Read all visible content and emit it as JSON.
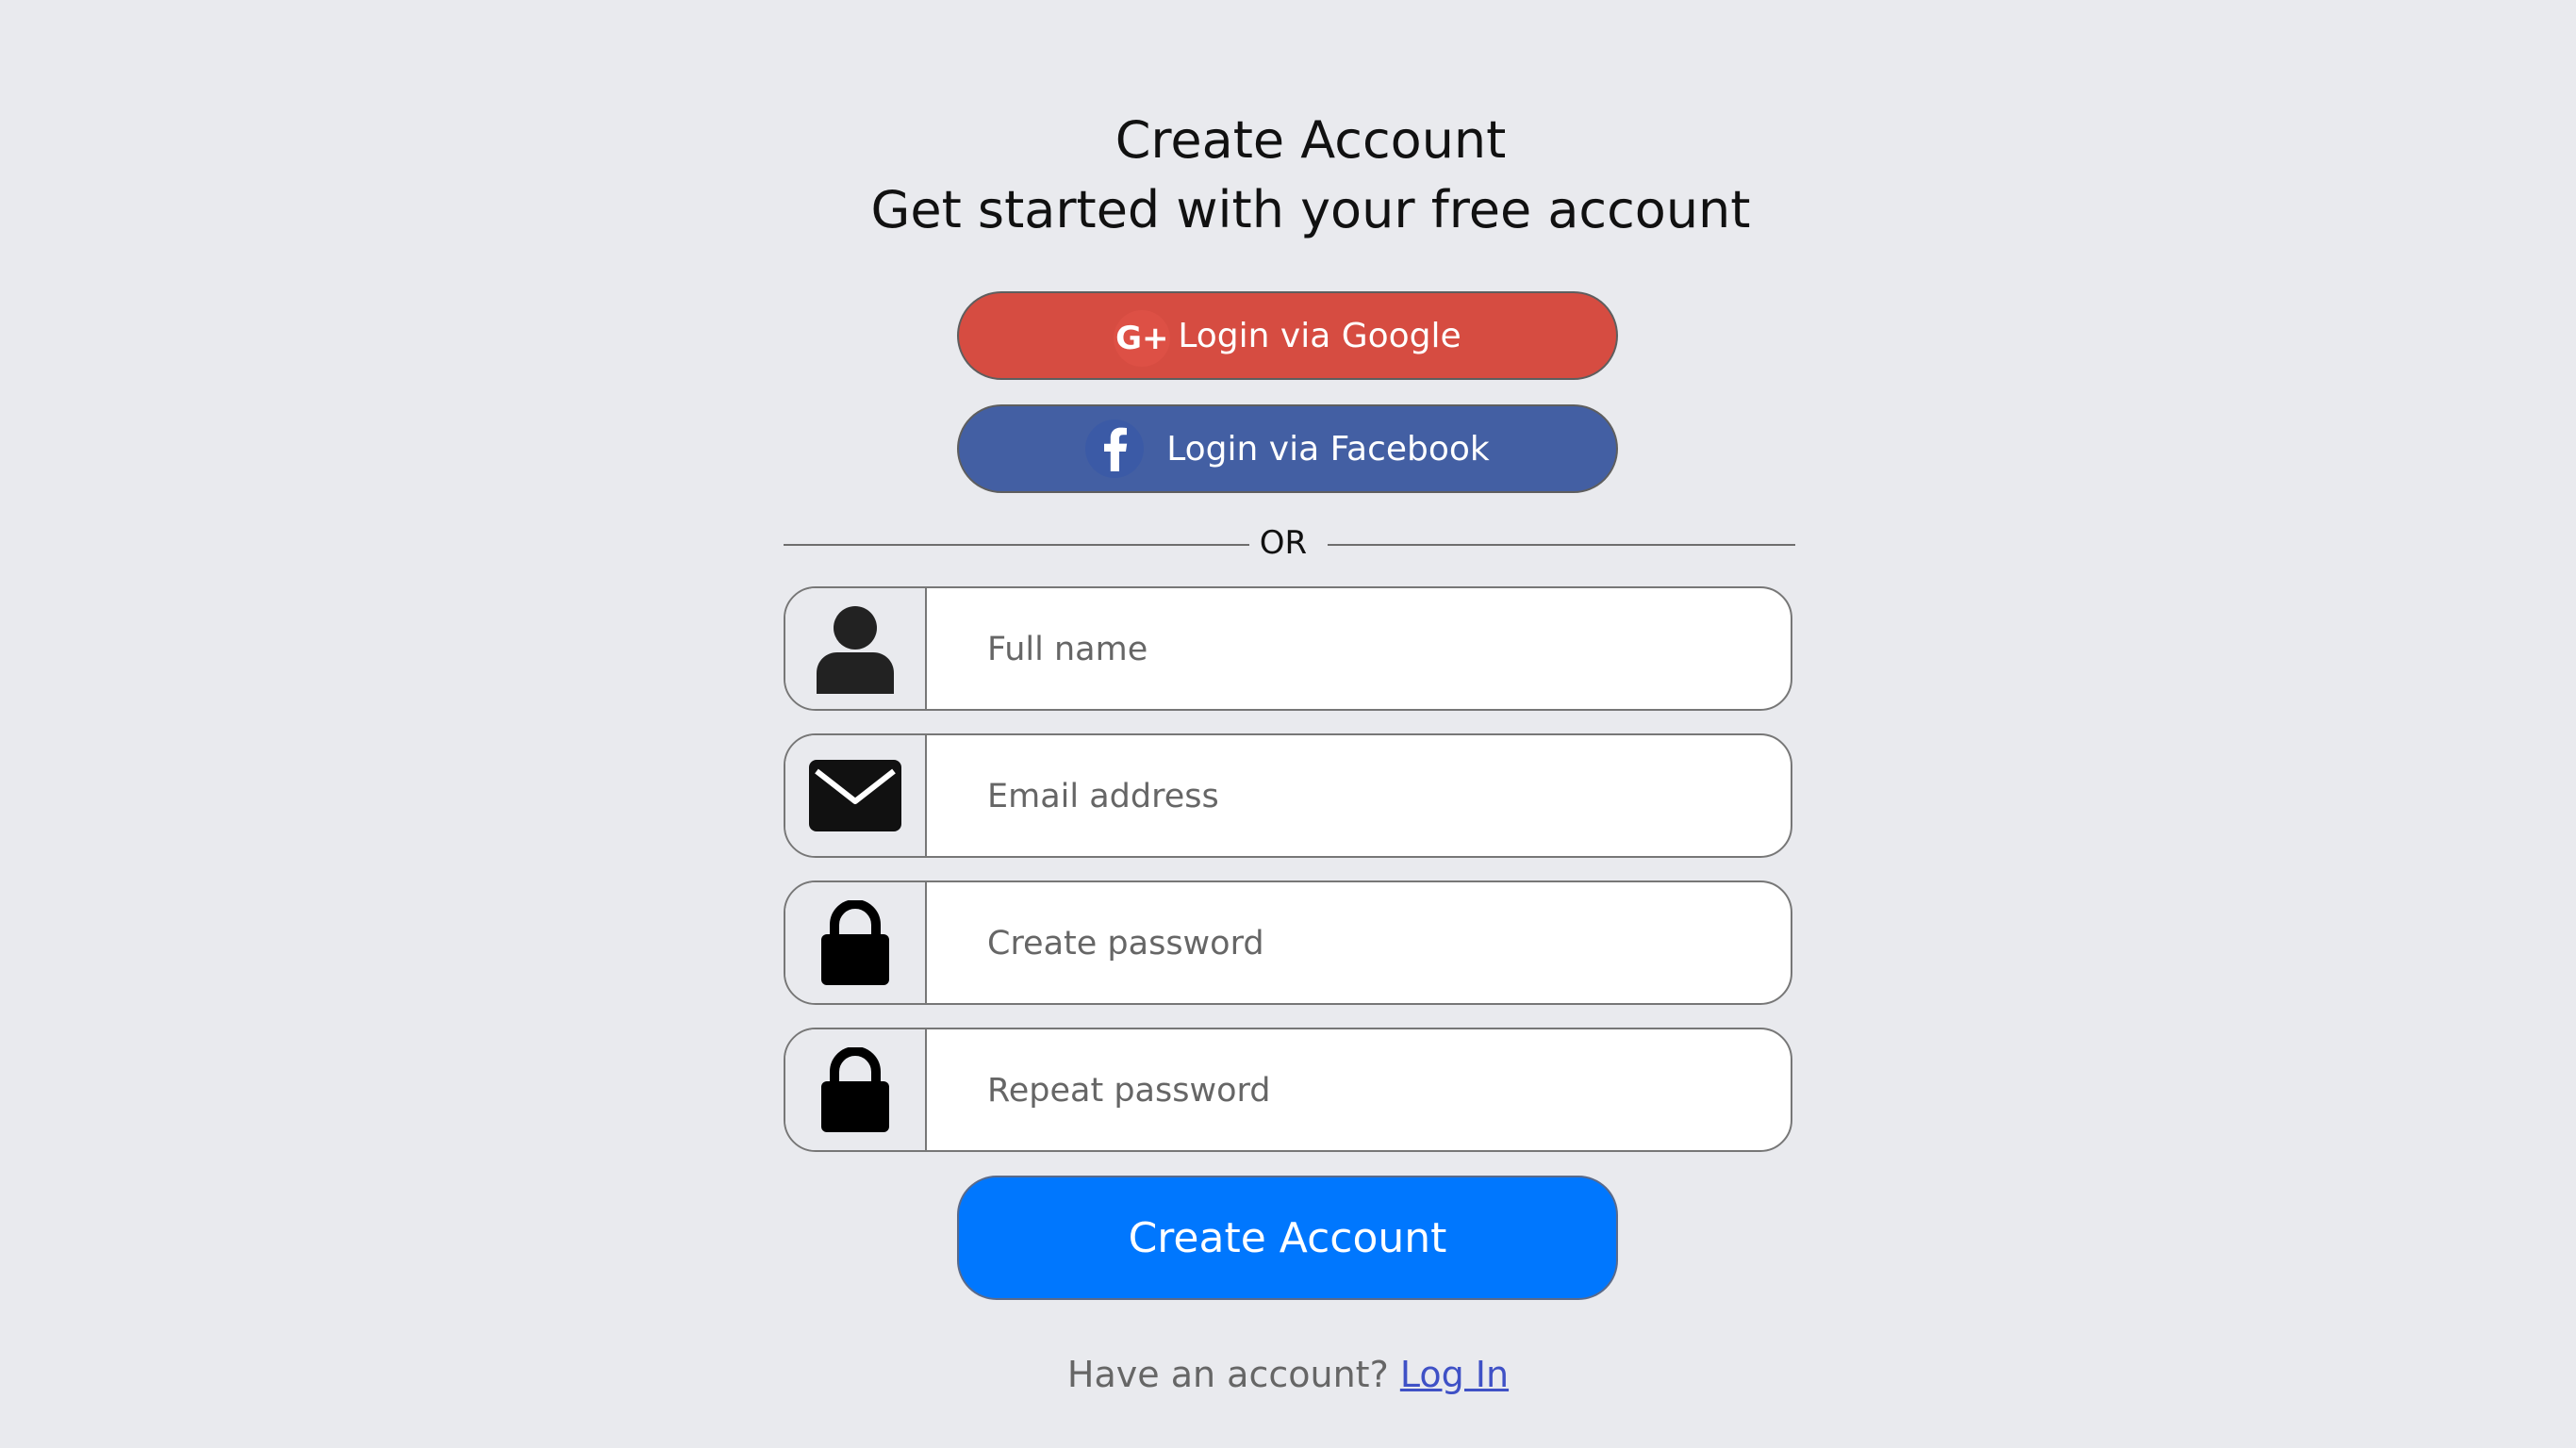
{
  "header": {
    "title": "Create Account",
    "subtitle": "Get started with your free account"
  },
  "social": {
    "google_label": "Login via Google",
    "google_icon": "google-plus-icon",
    "google_icon_text": "G+",
    "google_color": "#d64c41",
    "facebook_label": "Login via Facebook",
    "facebook_icon": "facebook-icon",
    "facebook_color": "#435fa3"
  },
  "divider": {
    "text": "OR"
  },
  "form": {
    "full_name": {
      "placeholder": "Full name",
      "value": "",
      "icon": "user-icon"
    },
    "email": {
      "placeholder": "Email address",
      "value": "",
      "icon": "envelope-icon"
    },
    "password": {
      "placeholder": "Create password",
      "value": "",
      "icon": "lock-icon"
    },
    "repeat_password": {
      "placeholder": "Repeat password",
      "value": "",
      "icon": "lock-icon"
    },
    "submit_label": "Create Account",
    "submit_color": "#0077fe"
  },
  "footer": {
    "prompt": "Have an account?",
    "login_link": "Log In"
  }
}
